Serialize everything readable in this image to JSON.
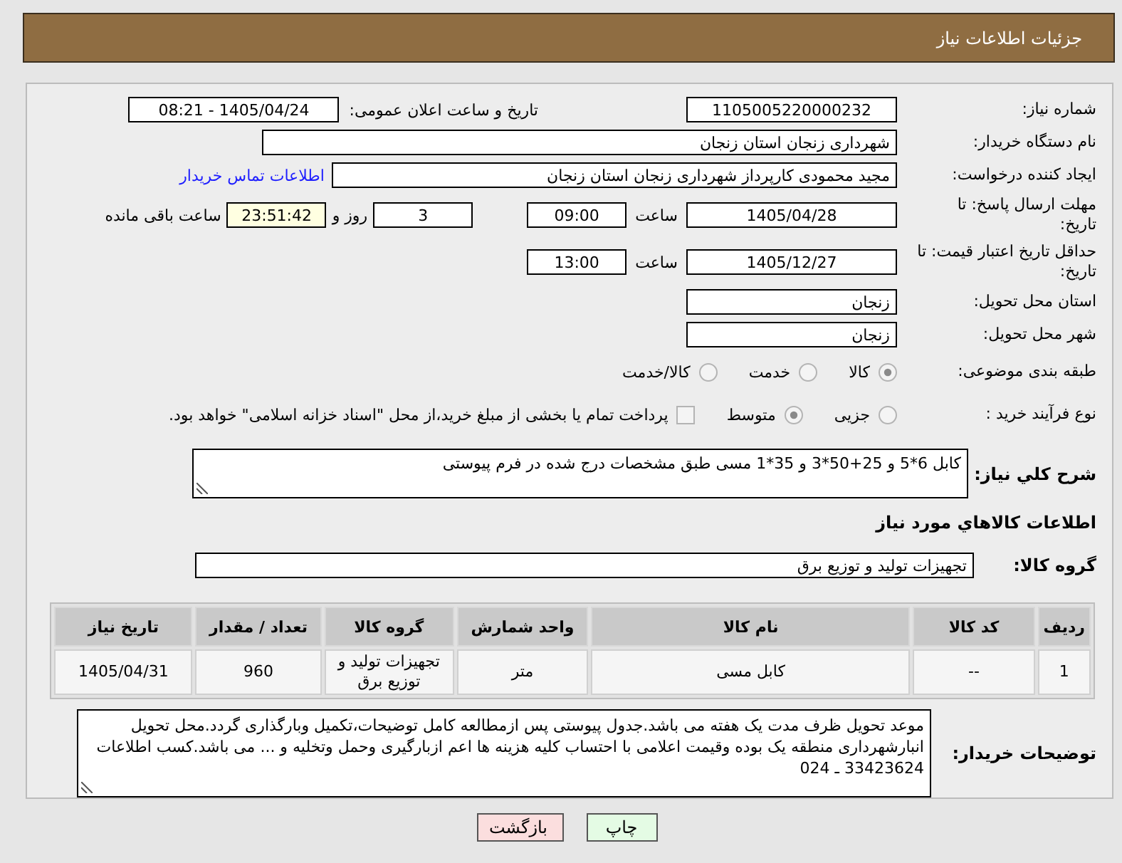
{
  "header": {
    "title": "جزئیات اطلاعات نیاز"
  },
  "need_number": {
    "label": "شماره نیاز:",
    "value": "1105005220000232"
  },
  "announcement": {
    "label": "تاریخ و ساعت اعلان عمومی:",
    "value": "1405/04/24 - 08:21"
  },
  "buyer_organization": {
    "label": "نام دستگاه خریدار:",
    "value": "شهرداری زنجان استان زنجان"
  },
  "requester": {
    "label": "ایجاد کننده درخواست:",
    "value": "مجید محمودی کارپرداز شهرداری زنجان استان زنجان",
    "contact_link": "اطلاعات تماس خریدار"
  },
  "response_deadline": {
    "label": "مهلت ارسال پاسخ: تا تاریخ:",
    "date": "1405/04/28",
    "time_label": "ساعت",
    "time": "09:00",
    "days": "3",
    "days_label": "روز و",
    "remaining": "23:51:42",
    "remaining_label": "ساعت باقی مانده"
  },
  "price_validity": {
    "label": "حداقل تاریخ اعتبار قیمت: تا تاریخ:",
    "date": "1405/12/27",
    "time_label": "ساعت",
    "time": "13:00"
  },
  "delivery_province": {
    "label": "استان محل تحویل:",
    "value": "زنجان"
  },
  "delivery_city": {
    "label": "شهر محل تحویل:",
    "value": "زنجان"
  },
  "subject_category": {
    "label": "طبقه بندی موضوعی:",
    "options": [
      {
        "label": "کالا",
        "selected": true
      },
      {
        "label": "خدمت",
        "selected": false
      },
      {
        "label": "کالا/خدمت",
        "selected": false
      }
    ]
  },
  "purchase_process": {
    "label": "نوع فرآیند خرید :",
    "options": [
      {
        "label": "جزیی",
        "selected": false
      },
      {
        "label": "متوسط",
        "selected": true
      }
    ],
    "treasury_payment": {
      "label": "پرداخت تمام یا بخشی از مبلغ خرید،از محل \"اسناد خزانه اسلامی\" خواهد بود.",
      "checked": false
    }
  },
  "description": {
    "label": "شرح کلي نیاز:",
    "value": "کابل 6*5 و 25+50*3 و 35*1 مسی طبق مشخصات درج شده در فرم پیوستی"
  },
  "goods_section": {
    "title": "اطلاعات کالاهاي مورد نیاز"
  },
  "goods_group": {
    "label": "گروه کالا:",
    "value": "تجهیزات تولید و توزیع برق"
  },
  "table": {
    "columns": [
      "ردیف",
      "کد کالا",
      "نام کالا",
      "واحد شمارش",
      "گروه کالا",
      "تعداد / مقدار",
      "تاریخ نیاز"
    ],
    "rows": [
      [
        "1",
        "--",
        "کابل مسی",
        "متر",
        "تجهیزات تولید و توزیع برق",
        "960",
        "1405/04/31"
      ]
    ]
  },
  "buyer_notes": {
    "label": "توضیحات خریدار:",
    "value": "موعد تحویل ظرف مدت یک هفته می باشد.جدول پیوستی پس ازمطالعه کامل توضیحات،تکمیل وبارگذاری گردد.محل تحویل انبارشهرداری منطقه یک بوده وقیمت اعلامی با احتساب کلیه هزینه ها اعم ازبارگیری وحمل وتخلیه و ... می باشد.کسب اطلاعات 33423624 ـ 024"
  },
  "buttons": [
    {
      "label": "چاپ",
      "kind": "print"
    },
    {
      "label": "بازگشت",
      "kind": "back"
    }
  ]
}
